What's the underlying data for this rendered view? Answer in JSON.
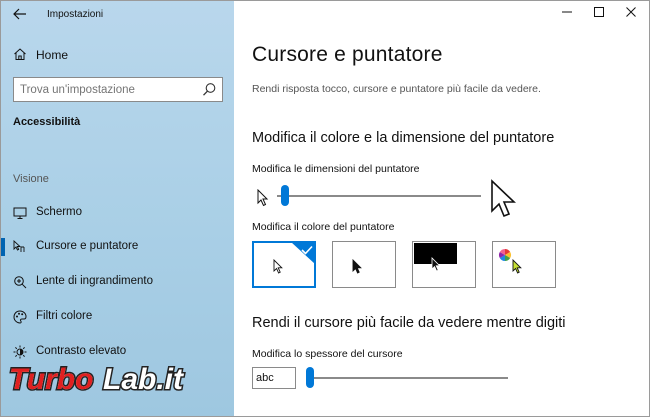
{
  "window": {
    "title": "Impostazioni",
    "controls": {
      "minimize": "—",
      "maximize": "☐",
      "close": "✕"
    }
  },
  "sidebar": {
    "back_icon": "back-arrow-icon",
    "home_label": "Home",
    "search_placeholder": "Trova un'impostazione",
    "section_title": "Accessibilità",
    "group_label": "Visione",
    "items": [
      {
        "label": "Schermo",
        "icon": "monitor-icon"
      },
      {
        "label": "Cursore e puntatore",
        "icon": "cursor-pointer-icon",
        "active": true
      },
      {
        "label": "Lente di ingrandimento",
        "icon": "magnifier-icon"
      },
      {
        "label": "Filtri colore",
        "icon": "color-palette-icon"
      },
      {
        "label": "Contrasto elevato",
        "icon": "contrast-icon"
      }
    ]
  },
  "main": {
    "title": "Cursore e puntatore",
    "description": "Rendi risposta tocco, cursore e puntatore più facile da vedere.",
    "pointer_section": {
      "title": "Modifica il colore e la dimensione del puntatore",
      "size_label": "Modifica le dimensioni del puntatore",
      "size_value": 0.02,
      "color_label": "Modifica il colore del puntatore",
      "color_options": [
        {
          "name": "white",
          "selected": true
        },
        {
          "name": "black",
          "selected": false
        },
        {
          "name": "inverted",
          "selected": false
        },
        {
          "name": "custom",
          "selected": false
        }
      ]
    },
    "cursor_section": {
      "title": "Rendi il cursore più facile da vedere mentre digiti",
      "thickness_label": "Modifica lo spessore del cursore",
      "preview_text": "abc",
      "thickness_value": 0.0
    }
  },
  "watermark": {
    "text": "TurboLab.it"
  },
  "colors": {
    "accent": "#0078d7",
    "sidebar_bg": "#b1d3ea",
    "watermark_red": "#e02020"
  }
}
